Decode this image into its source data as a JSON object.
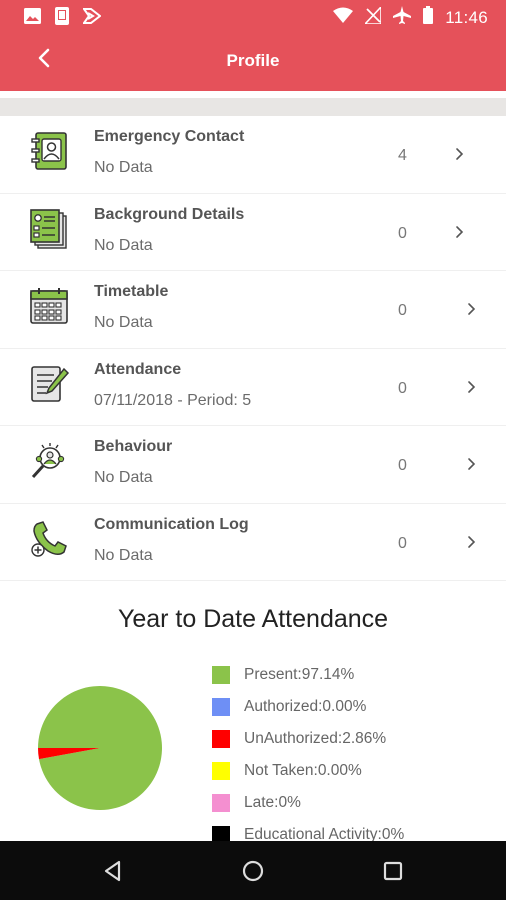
{
  "status_bar": {
    "time": "11:46"
  },
  "app_bar": {
    "title": "Profile"
  },
  "profile_items": [
    {
      "title": "Emergency Contact",
      "subtitle": "No Data",
      "count": "4",
      "icon": "contact-book-icon"
    },
    {
      "title": "Background Details",
      "subtitle": "No Data",
      "count": "0",
      "icon": "id-card-icon"
    },
    {
      "title": "Timetable",
      "subtitle": "No Data",
      "count": "0",
      "icon": "calendar-icon"
    },
    {
      "title": "Attendance",
      "subtitle": "07/11/2018 - Period: 5",
      "count": "0",
      "icon": "clipboard-pen-icon"
    },
    {
      "title": "Behaviour",
      "subtitle": "No Data",
      "count": "0",
      "icon": "magnifier-people-icon"
    },
    {
      "title": "Communication Log",
      "subtitle": "No Data",
      "count": "0",
      "icon": "phone-add-icon"
    }
  ],
  "attendance": {
    "heading": "Year to Date Attendance",
    "legend": [
      {
        "label": "Present:97.14%",
        "color": "#8bc34a"
      },
      {
        "label": "Authorized:0.00%",
        "color": "#6e8ff5"
      },
      {
        "label": "UnAuthorized:2.86%",
        "color": "#ff0000"
      },
      {
        "label": "Not Taken:0.00%",
        "color": "#ffff00"
      },
      {
        "label": "Late:0%",
        "color": "#f48fd0"
      },
      {
        "label": "Educational Activity:0%",
        "color": "#000000"
      }
    ]
  },
  "chart_data": {
    "type": "pie",
    "title": "Year to Date Attendance",
    "slices": [
      {
        "name": "Present",
        "value": 97.14,
        "color": "#8bc34a"
      },
      {
        "name": "Authorized",
        "value": 0.0,
        "color": "#6e8ff5"
      },
      {
        "name": "UnAuthorized",
        "value": 2.86,
        "color": "#ff0000"
      },
      {
        "name": "Not Taken",
        "value": 0.0,
        "color": "#ffff00"
      },
      {
        "name": "Late",
        "value": 0,
        "color": "#f48fd0"
      },
      {
        "name": "Educational Activity",
        "value": 0,
        "color": "#000000"
      }
    ],
    "legend_position": "right"
  },
  "colors": {
    "accent": "#e5515a",
    "divider": "#e8e6e4"
  },
  "nav_bar": {
    "buttons": [
      "back-triangle-icon",
      "home-circle-icon",
      "recents-square-icon"
    ]
  }
}
